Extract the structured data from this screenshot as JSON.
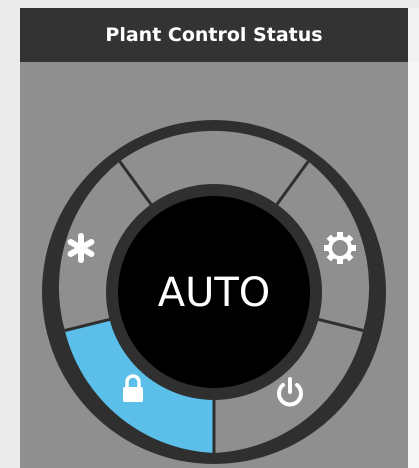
{
  "panel": {
    "title": "Plant Control Status"
  },
  "dial": {
    "mode": "AUTO",
    "segments": [
      {
        "id": "top",
        "icon": "none",
        "active": false
      },
      {
        "id": "upper-left",
        "icon": "snowflake-icon",
        "active": false
      },
      {
        "id": "upper-right",
        "icon": "gear-icon",
        "active": false
      },
      {
        "id": "lower-left",
        "icon": "lock-icon",
        "active": true
      },
      {
        "id": "lower-right",
        "icon": "power-icon",
        "active": false
      }
    ]
  },
  "colors": {
    "header_bg": "#333333",
    "panel_bg": "#8f8f8f",
    "dial_ring": "#2f2f2f",
    "segment_bg": "#8f8f8f",
    "active_segment": "#5bbfea",
    "center_bg": "#000000",
    "icon": "#ffffff"
  }
}
